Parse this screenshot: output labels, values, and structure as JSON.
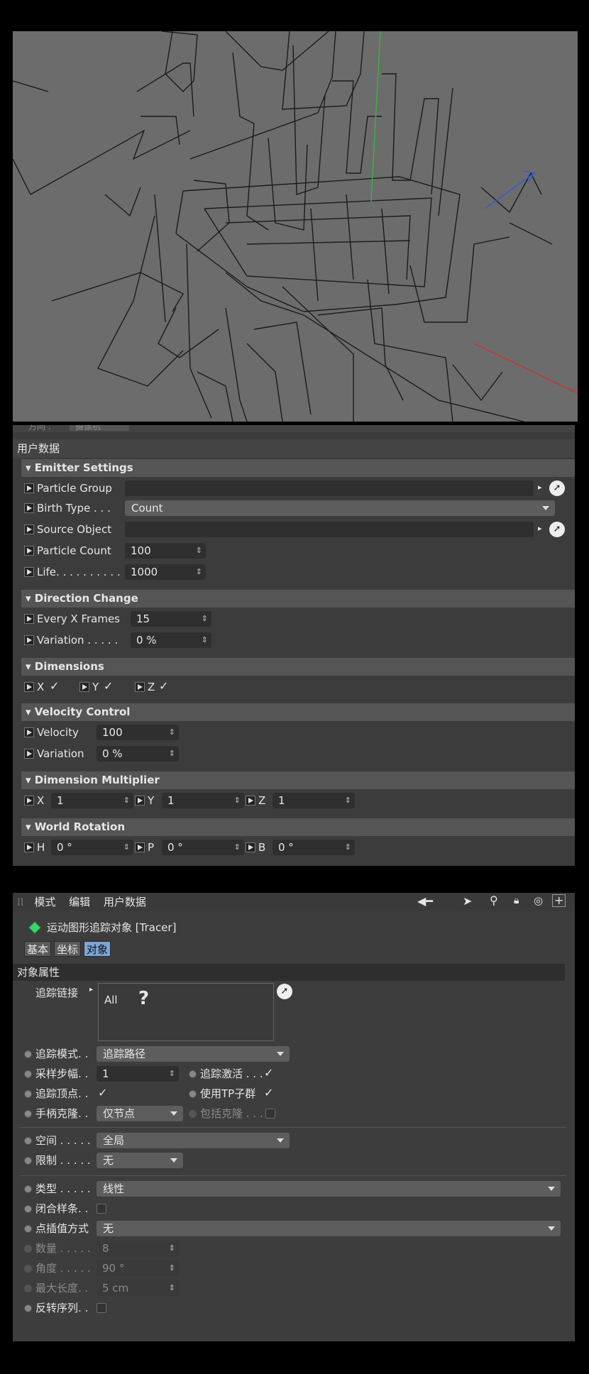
{
  "viewport": {
    "colors": {
      "background": "#6c6c6c",
      "y_axis": "#3bb143",
      "x_axis": "#c0392b",
      "z_axis": "#2f5fd0",
      "lines": "#1b1b1b"
    }
  },
  "panel1": {
    "cut_top_label": "方向 .",
    "cut_top_value": "摄像机",
    "user_data_title": "用户数据",
    "emitter": {
      "title": "Emitter Settings",
      "particle_group_label": "Particle Group",
      "birth_type_label": "Birth Type . . .",
      "birth_type_value": "Count",
      "source_object_label": "Source Object",
      "particle_count_label": "Particle Count",
      "particle_count_value": "100",
      "life_label": "Life. . . . . . . . . .",
      "life_value": "1000"
    },
    "direction": {
      "title": "Direction Change",
      "every_label": "Every X Frames",
      "every_value": "15",
      "variation_label": "Variation . . . . .",
      "variation_value": "0 %"
    },
    "dimensions": {
      "title": "Dimensions",
      "x": "X",
      "y": "Y",
      "z": "Z",
      "check": "✓"
    },
    "velocity": {
      "title": "Velocity Control",
      "velocity_label": "Velocity",
      "velocity_value": "100",
      "variation_label": "Variation",
      "variation_value": "0 %"
    },
    "multiplier": {
      "title": "Dimension Multiplier",
      "x": "X",
      "x_value": "1",
      "y": "Y",
      "y_value": "1",
      "z": "Z",
      "z_value": "1"
    },
    "rotation": {
      "title": "World Rotation",
      "h": "H",
      "h_value": "0 °",
      "p": "P",
      "p_value": "0 °",
      "b": "B",
      "b_value": "0 °"
    }
  },
  "panel2": {
    "menu": {
      "mode": "模式",
      "edit": "编辑",
      "user_data": "用户数据"
    },
    "object_title": "运动图形追踪对象 [Tracer]",
    "tabs": {
      "basic": "基本",
      "coord": "坐标",
      "object": "对象"
    },
    "section_title": "对象属性",
    "trace_link_label": "追踪链接",
    "trace_link_value": "All",
    "help_mark": "?",
    "trace_mode_label": "追踪模式. .",
    "trace_mode_value": "追踪路径",
    "sample_step_label": "采样步幅. .",
    "sample_step_value": "1",
    "trace_active_label": "追踪激活 . . .",
    "trace_vertices_label": "追踪顶点. .",
    "use_tp_label": "使用TP子群",
    "handle_clone_label": "手柄克隆. .",
    "handle_clone_value": "仅节点",
    "include_clone_label": "包括克隆 . . .",
    "space_label": "空间 . . . . .",
    "space_value": "全局",
    "limit_label": "限制 . . . . .",
    "limit_value": "无",
    "type_label": "类型 . . . . .",
    "type_value": "线性",
    "closed_spline_label": "闭合样条. .",
    "interp_label": "点插值方式",
    "interp_value": "无",
    "count_label": "数量 . . . . .",
    "count_value": "8",
    "angle_label": "角度 . . . . .",
    "angle_value": "90 °",
    "max_len_label": "最大长度. .",
    "max_len_value": "5 cm",
    "reverse_label": "反转序列. .",
    "check": "✓"
  }
}
